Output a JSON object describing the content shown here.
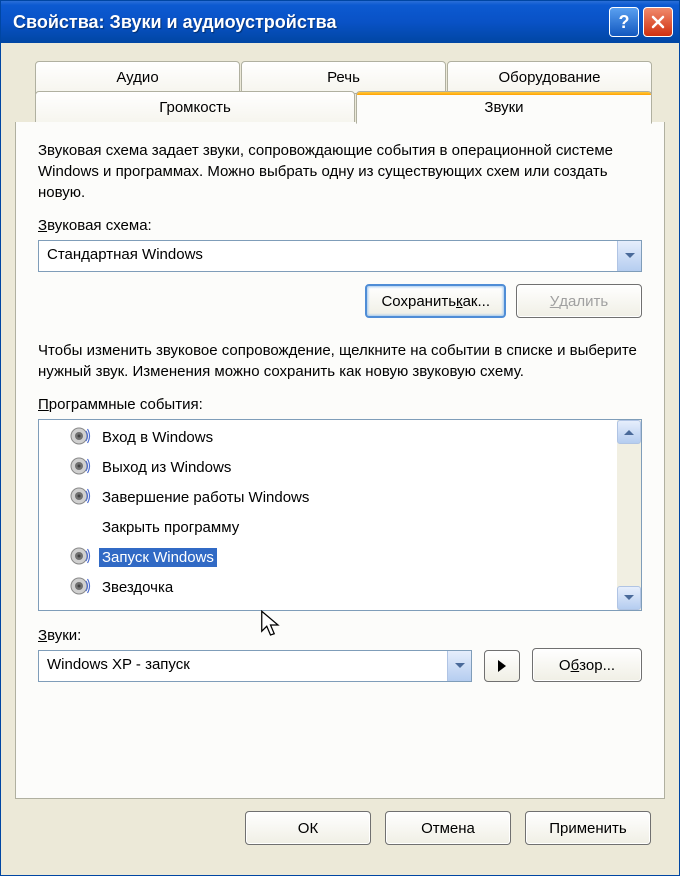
{
  "titlebar": {
    "title": "Свойства: Звуки и аудиоустройства"
  },
  "tabs": {
    "audio": "Аудио",
    "speech": "Речь",
    "hardware": "Оборудование",
    "volume": "Громкость",
    "sounds": "Звуки"
  },
  "panel": {
    "scheme_desc": "Звуковая схема задает звуки, сопровождающие события в операционной системе Windows и программах. Можно выбрать одну из существующих схем или создать новую.",
    "scheme_label": "Звуковая схема:",
    "scheme_value": "Стандартная Windows",
    "save_as_btn": "Сохранить как...",
    "delete_btn": "Удалить",
    "events_desc": "Чтобы изменить звуковое сопровождение, щелкните на событии в списке и выберите нужный звук. Изменения можно сохранить как новую звуковую схему.",
    "events_label": "Программные события:",
    "events": [
      {
        "label": "Вход в Windows",
        "has_sound": true,
        "selected": false
      },
      {
        "label": "Выход из Windows",
        "has_sound": true,
        "selected": false
      },
      {
        "label": "Завершение работы Windows",
        "has_sound": true,
        "selected": false
      },
      {
        "label": "Закрыть программу",
        "has_sound": false,
        "selected": false
      },
      {
        "label": "Запуск Windows",
        "has_sound": true,
        "selected": true
      },
      {
        "label": "Звездочка",
        "has_sound": true,
        "selected": false
      }
    ],
    "sounds_label": "Звуки:",
    "sounds_value": "Windows XP - запуск",
    "browse_btn": "Обзор..."
  },
  "buttons": {
    "ok": "ОК",
    "cancel": "Отмена",
    "apply": "Применить"
  }
}
